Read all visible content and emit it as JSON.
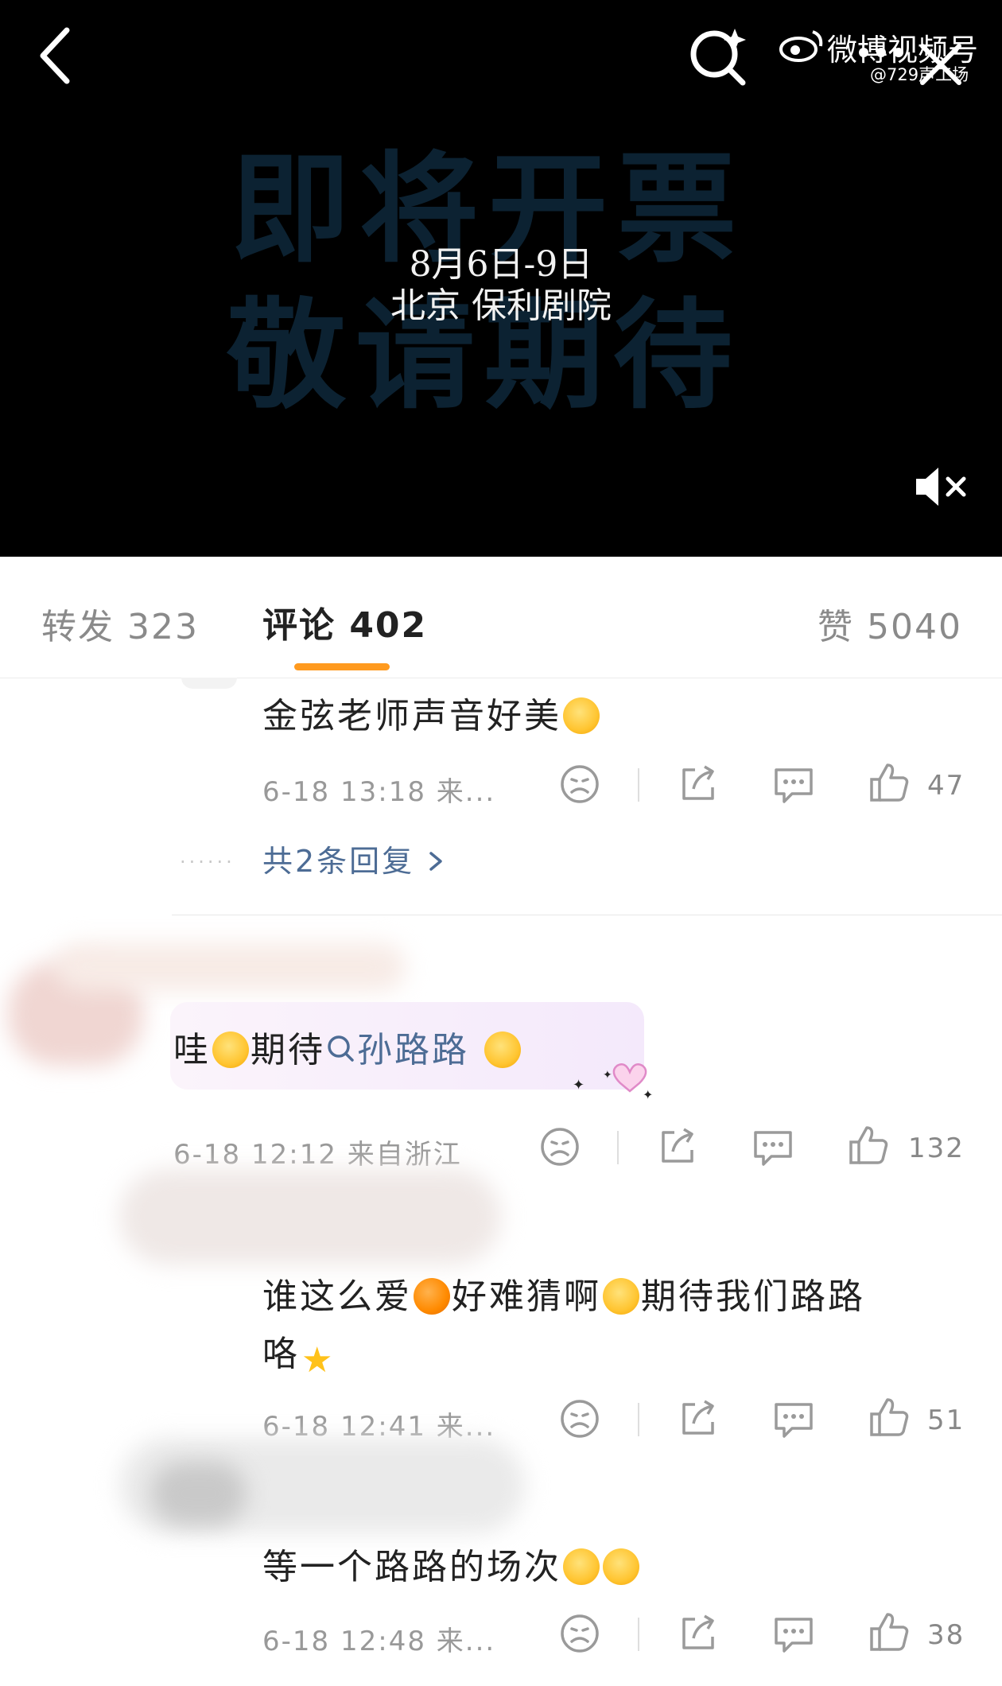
{
  "video": {
    "big_line1": "即将开票",
    "big_line2": "敬请期待",
    "date_line": "8月6日-9日",
    "venue_line": "北京 保利剧院",
    "brand_name": "微博视频号",
    "brand_handle": "@729声工场"
  },
  "tabs": {
    "repost": "转发 323",
    "comments": "评论 402",
    "likes": "赞 5040"
  },
  "comments": [
    {
      "text": "金弦老师声音好美",
      "time": "6-18 13:18 来...",
      "likes": "47",
      "replies_label": "共2条回复"
    },
    {
      "text_before": "哇",
      "text_mid": "期待",
      "mention": "孙路路",
      "time": "6-18 12:12 来自浙江",
      "likes": "132"
    },
    {
      "text_a": "谁这么爱",
      "text_b": "好难猜啊",
      "text_c": "期待我们路路",
      "text_d": "咯",
      "time": "6-18 12:41 来...",
      "likes": "51"
    },
    {
      "text": "等一个路路的场次",
      "time": "6-18 12:48 来...",
      "likes": "38"
    }
  ],
  "icons": {
    "back": "back-arrow-icon",
    "search": "search-icon",
    "close": "close-icon",
    "mute": "mute-icon",
    "dislike": "unhappy-face-icon",
    "share": "share-icon",
    "reply": "comment-icon",
    "like": "thumb-up-icon"
  },
  "colors": {
    "accent": "#ff9a1f",
    "link": "#4d6c95",
    "video_bg": "#000000"
  }
}
